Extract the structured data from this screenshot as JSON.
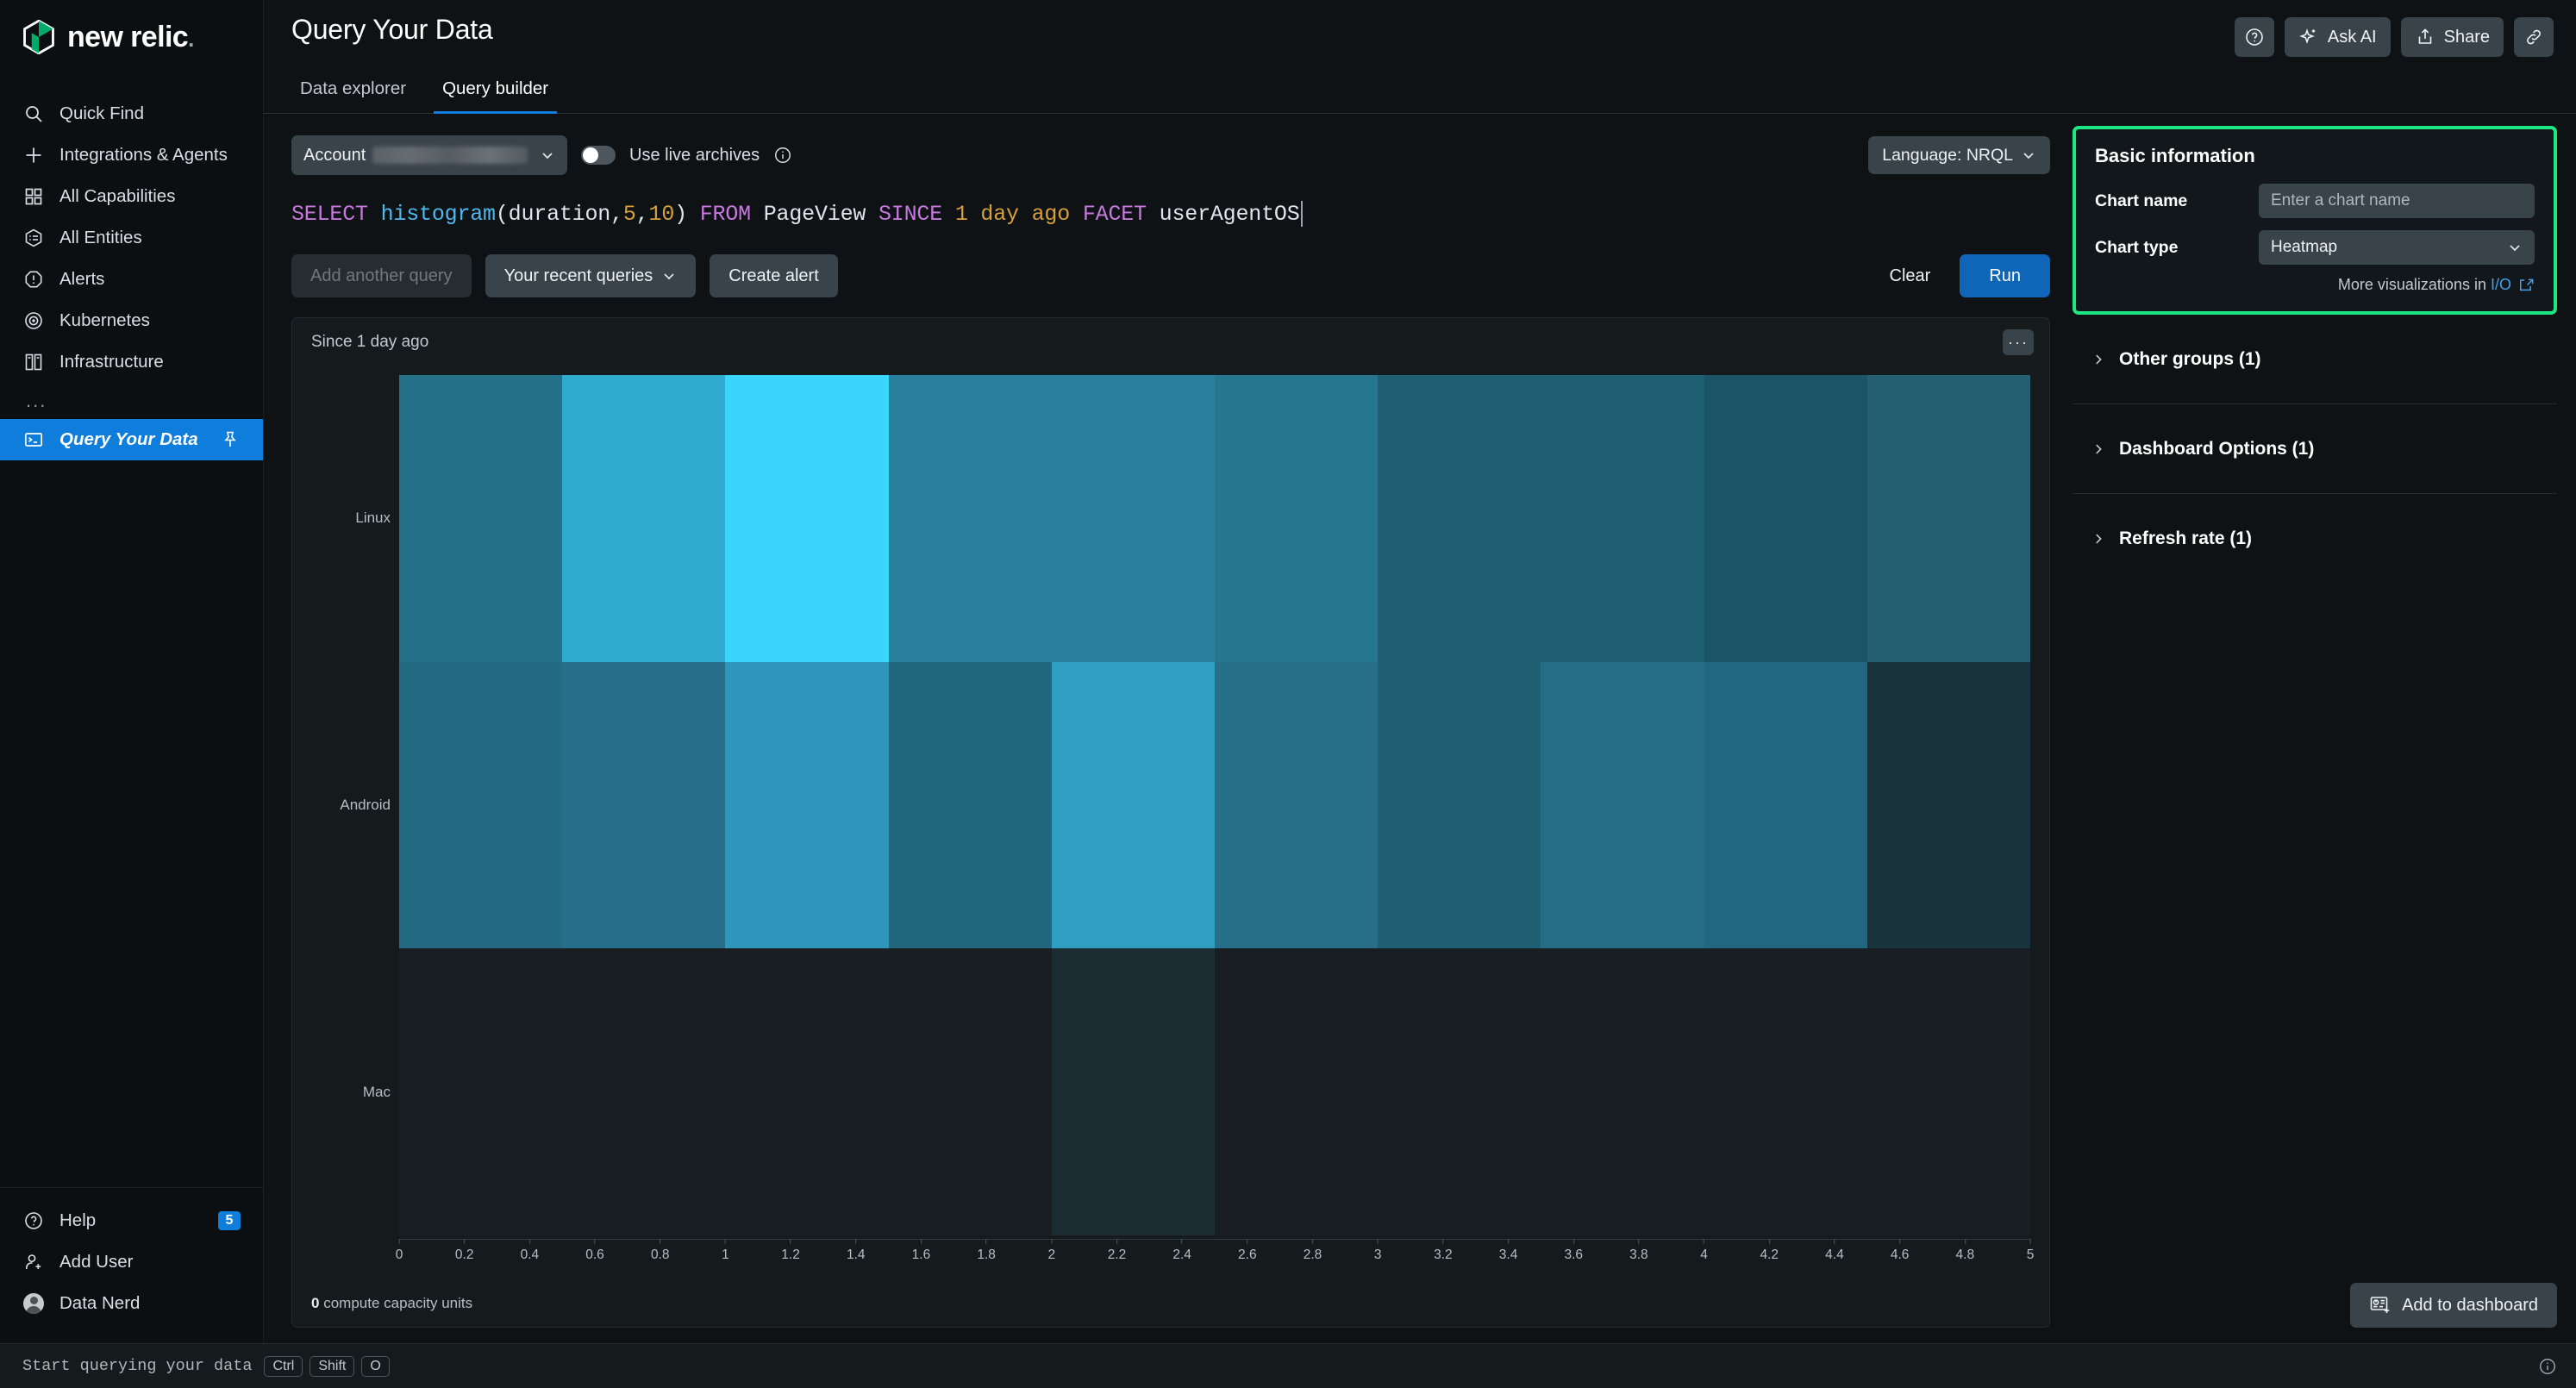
{
  "brand": {
    "name": "new relic",
    "trademark": "."
  },
  "sidebar": {
    "items": [
      {
        "label": "Quick Find",
        "icon": "search-icon"
      },
      {
        "label": "Integrations & Agents",
        "icon": "plus-icon"
      },
      {
        "label": "All Capabilities",
        "icon": "grid-icon"
      },
      {
        "label": "All Entities",
        "icon": "entities-icon"
      },
      {
        "label": "Alerts",
        "icon": "alert-octagon-icon"
      },
      {
        "label": "Kubernetes",
        "icon": "kubernetes-icon"
      },
      {
        "label": "Infrastructure",
        "icon": "infrastructure-icon"
      }
    ],
    "more_label": "...",
    "active_item": {
      "label": "Query Your Data",
      "icon": "terminal-icon",
      "pin_icon": "pin-icon"
    },
    "bottom": [
      {
        "label": "Help",
        "icon": "help-circle-icon",
        "badge": "5"
      },
      {
        "label": "Add User",
        "icon": "add-user-icon",
        "badge": ""
      },
      {
        "label": "Data Nerd",
        "icon": "avatar",
        "badge": ""
      }
    ]
  },
  "header": {
    "title": "Query Your Data",
    "actions": [
      {
        "label": "",
        "icon": "help-circle-icon",
        "name": "help-button"
      },
      {
        "label": "Ask AI",
        "icon": "sparkle-icon",
        "name": "ask-ai-button"
      },
      {
        "label": "Share",
        "icon": "share-icon",
        "name": "share-button"
      },
      {
        "label": "",
        "icon": "link-icon",
        "name": "copy-link-button"
      }
    ]
  },
  "tabs": [
    {
      "label": "Data explorer",
      "active": false
    },
    {
      "label": "Query builder",
      "active": true
    }
  ],
  "query_controls": {
    "account_label": "Account",
    "account_value_redacted": true,
    "live_archives_label": "Use live archives",
    "live_archives_on": false,
    "info_icon": "info-circle-icon",
    "language_label": "Language: NRQL"
  },
  "nrql": {
    "tokens": [
      {
        "t": "SELECT ",
        "c": "kw"
      },
      {
        "t": "histogram",
        "c": "fn"
      },
      {
        "t": "(duration,",
        "c": "pl"
      },
      {
        "t": "5",
        "c": "num"
      },
      {
        "t": ",",
        "c": "pl"
      },
      {
        "t": "10",
        "c": "num"
      },
      {
        "t": ") ",
        "c": "pl"
      },
      {
        "t": "FROM ",
        "c": "kw"
      },
      {
        "t": "PageView ",
        "c": "pl"
      },
      {
        "t": "SINCE ",
        "c": "kw"
      },
      {
        "t": "1 day ago ",
        "c": "num"
      },
      {
        "t": "FACET ",
        "c": "kw"
      },
      {
        "t": "userAgentOS",
        "c": "pl"
      }
    ],
    "plain": "SELECT histogram(duration,5,10) FROM PageView SINCE 1 day ago FACET userAgentOS"
  },
  "query_buttons": {
    "add_another": "Add another query",
    "recent_queries": "Your recent queries",
    "create_alert": "Create alert",
    "clear": "Clear",
    "run": "Run"
  },
  "chart_panel": {
    "since": "Since 1 day ago",
    "menu_icon": "ellipsis-icon",
    "footer_count": "0",
    "footer_label": "compute capacity units"
  },
  "chart_data": {
    "type": "heatmap",
    "title": "Since 1 day ago",
    "xlabel": "",
    "ylabel": "",
    "xlim": [
      0,
      5
    ],
    "grid": false,
    "legend": "none",
    "x_ticks": [
      "0",
      "0.2",
      "0.4",
      "0.6",
      "0.8",
      "1",
      "1.2",
      "1.4",
      "1.6",
      "1.8",
      "2",
      "2.2",
      "2.4",
      "2.6",
      "2.8",
      "3",
      "3.2",
      "3.4",
      "3.6",
      "3.8",
      "4",
      "4.2",
      "4.4",
      "4.6",
      "4.8",
      "5"
    ],
    "bucket_edges": [
      0,
      0.5,
      1.0,
      1.5,
      2.0,
      2.5,
      3.0,
      3.5,
      4.0,
      4.5,
      5.0
    ],
    "categories": [
      "Linux",
      "Android",
      "Mac"
    ],
    "series": [
      {
        "name": "Linux",
        "colors": [
          "#25718a",
          "#2fabd0",
          "#3ad5fb",
          "#2a7f9c",
          "#2a7f9c",
          "#27768f",
          "#1f5f74",
          "#1f5f74",
          "#1b5467",
          "#245f72"
        ]
      },
      {
        "name": "Android",
        "colors": [
          "#256a83",
          "#256f8a",
          "#2d96ba",
          "#22667e",
          "#309ec2",
          "#276e88",
          "#1f5f74",
          "#256c85",
          "#226780",
          "#18333c"
        ]
      },
      {
        "name": "Mac",
        "colors": [
          "#181e21",
          "#181e21",
          "#181e21",
          "#181e21",
          "#1b2d33",
          "#181e21",
          "#181e21",
          "#181e21",
          "#181e21",
          "#181e21"
        ]
      }
    ]
  },
  "right_panel": {
    "basic_information": {
      "title": "Basic information",
      "chart_name_label": "Chart name",
      "chart_name_placeholder": "Enter a chart name",
      "chart_name_value": "",
      "chart_type_label": "Chart type",
      "chart_type_value": "Heatmap",
      "more_viz_prefix": "More visualizations in ",
      "more_viz_link": "I/O",
      "external_icon": "external-link-icon",
      "highlight_color": "#1ce783"
    },
    "sections": [
      {
        "label": "Other groups (1)"
      },
      {
        "label": "Dashboard Options (1)"
      },
      {
        "label": "Refresh rate (1)"
      }
    ],
    "add_to_dashboard": {
      "label": "Add to dashboard",
      "icon": "dashboard-add-icon"
    }
  },
  "statusbar": {
    "text": "Start querying your data",
    "keys": [
      "Ctrl",
      "Shift",
      "O"
    ],
    "info_icon": "info-circle-icon"
  }
}
